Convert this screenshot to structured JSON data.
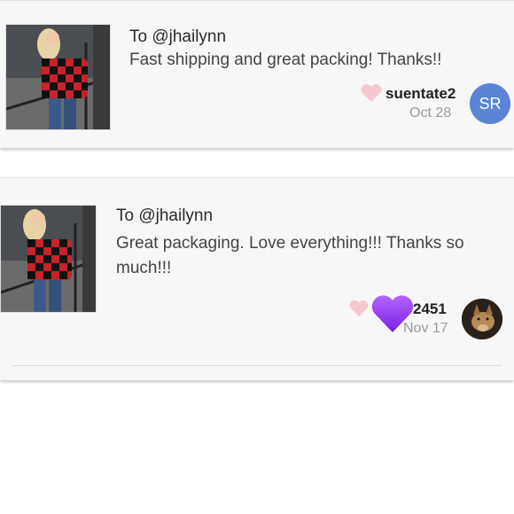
{
  "comments": [
    {
      "to": "To @jhailynn",
      "message": "Fast shipping and great packing! Thanks!!",
      "username": "suentate2",
      "date": "Oct 28",
      "avatar_initials": "SR",
      "avatar_color": "#5b84d6",
      "heart_color": "#f7c7cf"
    },
    {
      "to": "To @jhailynn",
      "message": "Great packaging. Love everything!!! Thanks so much!!!",
      "username": "2451",
      "date": "Nov 17",
      "heart_color": "#f7c7cf",
      "overlay_heart_color": "#9b3ef0"
    }
  ]
}
